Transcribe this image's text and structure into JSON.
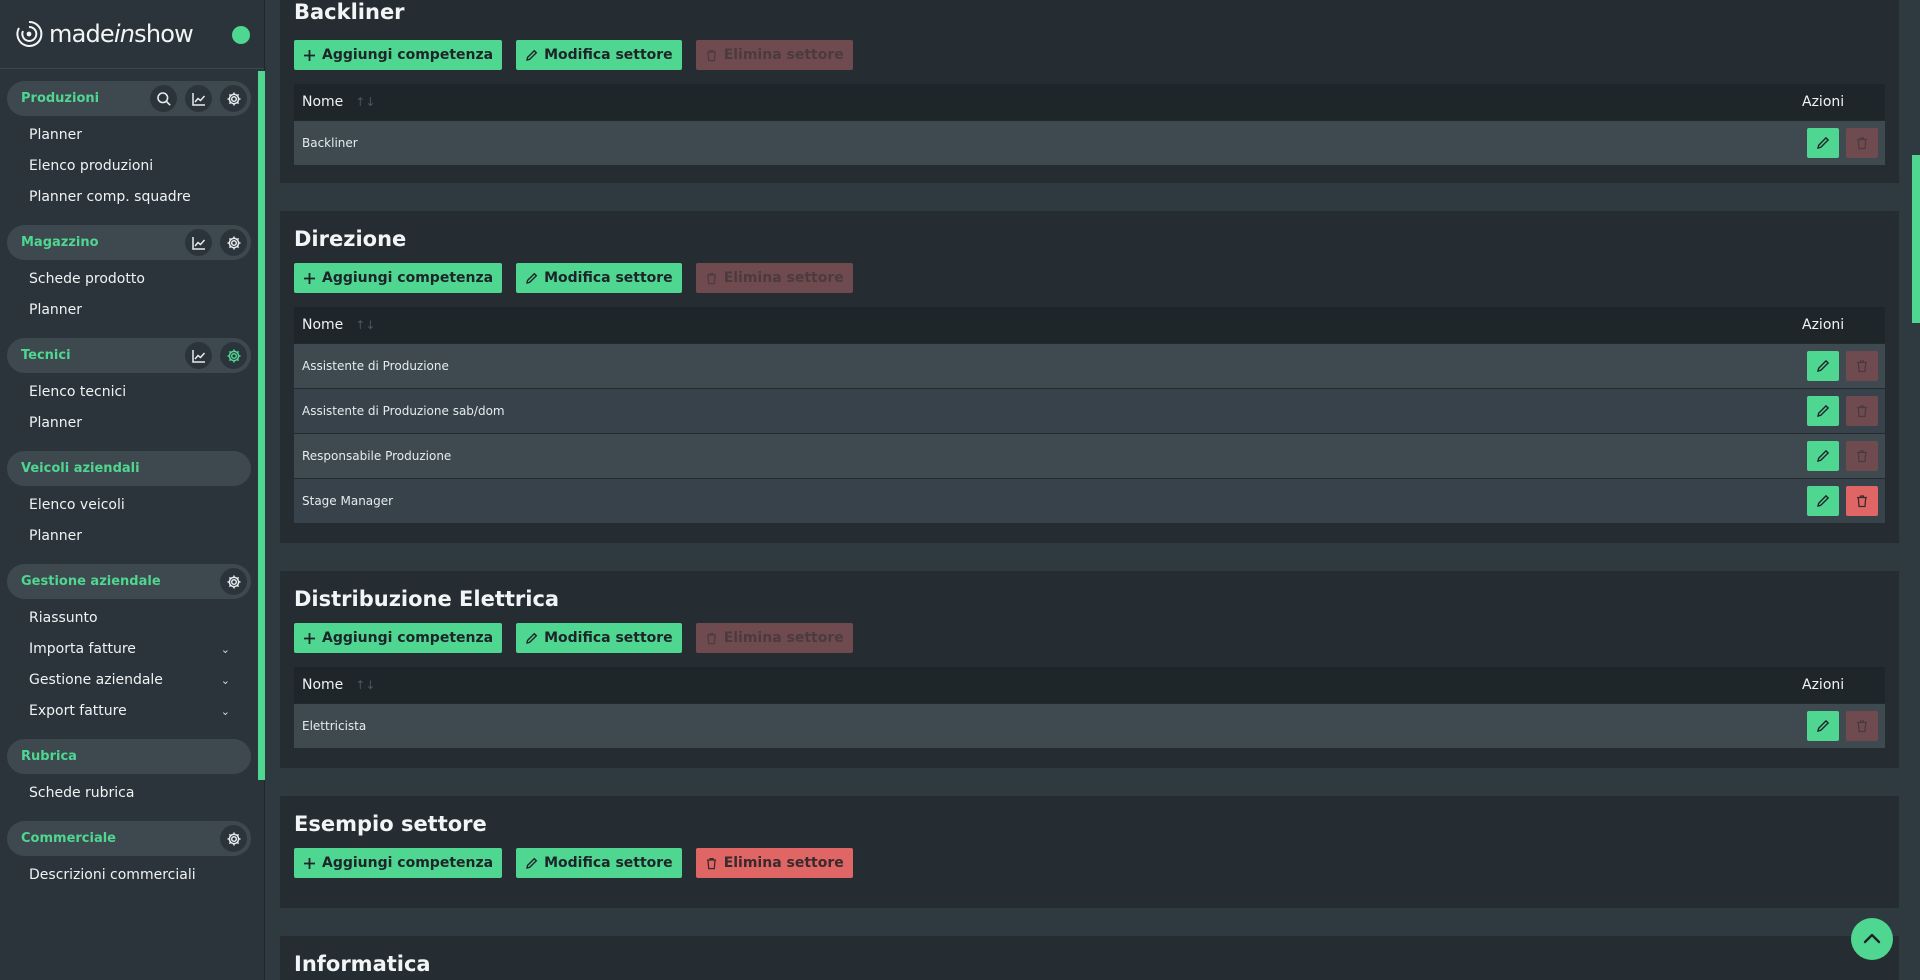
{
  "app": {
    "logo_prefix": "made",
    "logo_italic": "in",
    "logo_suffix": "show"
  },
  "sidebar": {
    "sections": [
      {
        "title": "Produzioni",
        "tools": [
          "search-icon",
          "chart-icon",
          "gear-icon"
        ],
        "items": [
          "Planner",
          "Elenco produzioni",
          "Planner comp. squadre"
        ]
      },
      {
        "title": "Magazzino",
        "tools": [
          "chart-icon",
          "gear-icon"
        ],
        "items": [
          "Schede prodotto",
          "Planner"
        ]
      },
      {
        "title": "Tecnici",
        "tools": [
          "chart-icon",
          "gear-icon"
        ],
        "items": [
          "Elenco tecnici",
          "Planner"
        ]
      },
      {
        "title": "Veicoli aziendali",
        "tools": [],
        "items": [
          "Elenco veicoli",
          "Planner"
        ]
      },
      {
        "title": "Gestione aziendale",
        "tools": [
          "gear-icon"
        ],
        "items": [
          "Riassunto",
          "Importa fatture",
          "Gestione aziendale",
          "Export fatture"
        ]
      },
      {
        "title": "Rubrica",
        "tools": [],
        "items": [
          "Schede rubrica"
        ]
      },
      {
        "title": "Commerciale",
        "tools": [
          "gear-icon"
        ],
        "items": [
          "Descrizioni commerciali"
        ]
      }
    ]
  },
  "buttons": {
    "add": "Aggiungi competenza",
    "edit": "Modifica settore",
    "delete": "Elimina settore"
  },
  "table": {
    "col_name": "Nome",
    "col_actions": "Azioni"
  },
  "sectors": [
    {
      "title": "Backliner",
      "rows": [
        "Backliner"
      ]
    },
    {
      "title": "Direzione",
      "rows": [
        "Assistente di Produzione",
        "Assistente di Produzione sab/dom",
        "Responsabile Produzione",
        "Stage Manager"
      ]
    },
    {
      "title": "Distribuzione Elettrica",
      "rows": [
        "Elettricista"
      ]
    },
    {
      "title": "Esempio settore",
      "rows": []
    },
    {
      "title": "Informatica",
      "rows": []
    }
  ],
  "colors": {
    "accent": "#4fd691",
    "danger": "#e06666",
    "danger_disabled": "#6f4b4f"
  }
}
